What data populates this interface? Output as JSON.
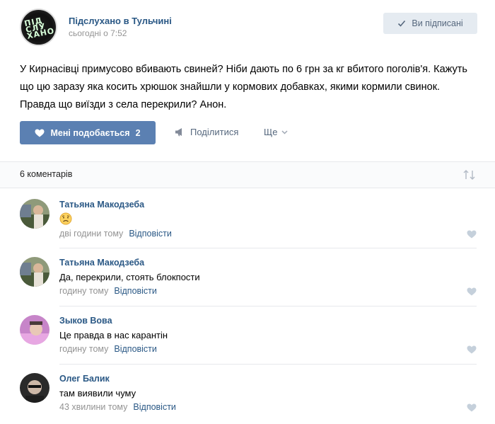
{
  "post": {
    "group_name": "Підслухано в Тульчині",
    "time": "сьогодні о 7:52",
    "avatar_text": "ПІД СЛУ ХАНО",
    "subscribed_label": "Ви підписані",
    "text": "У Кирнасівці примусово вбивають свиней? Ніби дають по 6 грн за кг вбитого поголів'я. Кажуть що цю заразу яка косить хрюшок знайшли у кормових добавках, якими кормили свинок. Правда що виїзди з села перекрили? Анон.",
    "like_label": "Мені подобається",
    "like_count": "2",
    "share_label": "Поділитися",
    "more_label": "Ще"
  },
  "comments_header": {
    "count_label": "6 коментарів"
  },
  "comments": [
    {
      "author": "Татьяна Макодзеба",
      "text": "",
      "emoji": "sad-face",
      "time": "дві години тому",
      "reply_label": "Відповісти"
    },
    {
      "author": "Татьяна Макодзеба",
      "text": "Да, перекрили, стоять блокпости",
      "time": "годину тому",
      "reply_label": "Відповісти"
    },
    {
      "author": "Зыков Вова",
      "text": "Це правда в нас карантін",
      "time": "годину тому",
      "reply_label": "Відповісти"
    },
    {
      "author": "Олег Балик",
      "text": "там виявили чуму",
      "time": "43 хвилини тому",
      "reply_label": "Відповісти"
    }
  ],
  "colors": {
    "link": "#2a5885",
    "like_button": "#5b80b2",
    "muted": "#939393",
    "subscribed_bg": "#e5ebf1"
  }
}
